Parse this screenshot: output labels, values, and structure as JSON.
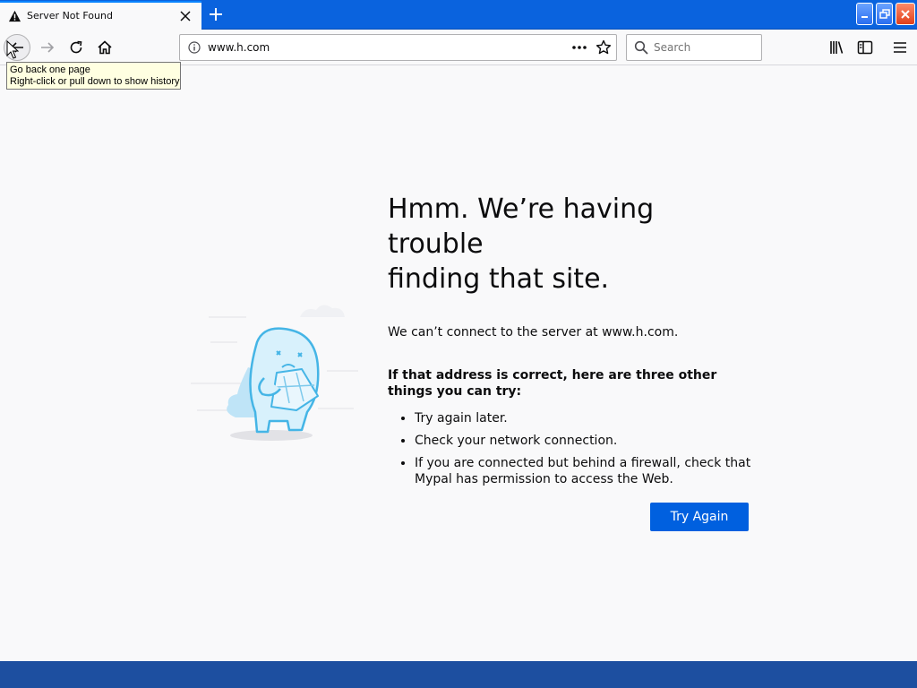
{
  "tab": {
    "title": "Server Not Found"
  },
  "navbar": {
    "url": "www.h.com",
    "search_placeholder": "Search"
  },
  "tooltip": {
    "line1": "Go back one page",
    "line2": "Right-click or pull down to show history"
  },
  "error": {
    "title_line1": "Hmm. We’re having trouble",
    "title_line2": "finding that site.",
    "short_desc": "We can’t connect to the server at www.h.com.",
    "heading": "If that address is correct, here are three other things you can try:",
    "suggestions": [
      "Try again later.",
      "Check your network connection.",
      "If you are connected but behind a firewall, check that Mypal has permission to access the Web."
    ],
    "try_again_label": "Try Again"
  },
  "colors": {
    "accent": "#0060df",
    "tab_strip": "#0a63de",
    "taskbar": "#1d4fa0"
  }
}
